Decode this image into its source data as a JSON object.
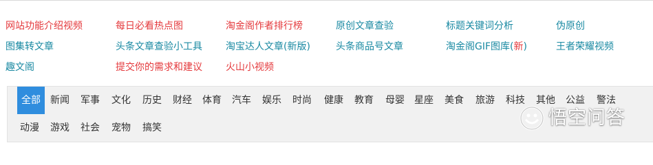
{
  "links": {
    "row1": [
      {
        "label": "网站功能介绍视频",
        "color": "red"
      },
      {
        "label": "每日必看热点图",
        "color": "red"
      },
      {
        "label": "淘金阁作者排行榜",
        "color": "red"
      },
      {
        "label": "原创文章查验",
        "color": "teal"
      },
      {
        "label": "标题关键词分析",
        "color": "teal"
      },
      {
        "label": "伪原创",
        "color": "teal"
      }
    ],
    "row2": [
      {
        "label": "图集转文章",
        "color": "teal"
      },
      {
        "label": "头条文章查验小工具",
        "color": "teal"
      },
      {
        "label": "淘宝达人文章(新版)",
        "color": "teal"
      },
      {
        "label": "头条商品号文章",
        "color": "teal"
      },
      {
        "label_prefix": "淘金阁GIF图库(",
        "label_new": "新",
        "label_suffix": ")",
        "color": "teal"
      },
      {
        "label": "王者荣耀视频",
        "color": "teal"
      }
    ],
    "row3": [
      {
        "label": "趣文阁",
        "color": "teal"
      },
      {
        "label": "提交你的需求和建议",
        "color": "red"
      },
      {
        "label": "火山小视频",
        "color": "red"
      }
    ]
  },
  "categories": {
    "row1": [
      "全部",
      "新闻",
      "军事",
      "文化",
      "历史",
      "财经",
      "体育",
      "汽车",
      "娱乐",
      "时尚",
      "健康",
      "教育",
      "母婴",
      "星座",
      "美食",
      "旅游",
      "科技",
      "其他",
      "公益",
      "警法"
    ],
    "row2": [
      "动漫",
      "游戏",
      "社会",
      "宠物",
      "搞笑"
    ],
    "active": "全部"
  },
  "watermark": {
    "text": "悟空问答"
  },
  "colors": {
    "red": "#e4393c",
    "teal": "#1989a2",
    "active_bg": "#2f8dde",
    "panel_bg": "#f1f1f1"
  }
}
